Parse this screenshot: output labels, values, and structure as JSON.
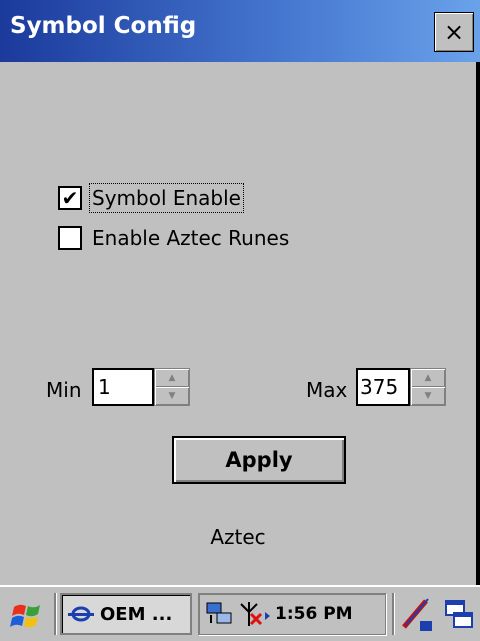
{
  "window": {
    "title": "Symbol Config",
    "close_label": "×"
  },
  "form": {
    "symbol_enable": {
      "label": "Symbol Enable",
      "checked": true
    },
    "aztec_runes": {
      "label": "Enable Aztec Runes",
      "checked": false
    },
    "min": {
      "label": "Min",
      "value": "1"
    },
    "max": {
      "label": "Max",
      "value": "375"
    },
    "apply_label": "Apply",
    "status": "Aztec"
  },
  "taskbar": {
    "task_label": "OEM ...",
    "clock": "1:56 PM"
  },
  "colors": {
    "title_gradient_start": "#1b3a9c",
    "title_gradient_end": "#6aa2ea",
    "face": "#c0c0c0"
  },
  "icons": {
    "start": "windows-flag-icon",
    "task": "oem-app-icon",
    "network": "network-icon",
    "antenna": "antenna-off-icon",
    "input": "pen-input-icon",
    "desktop": "show-desktop-icon"
  }
}
